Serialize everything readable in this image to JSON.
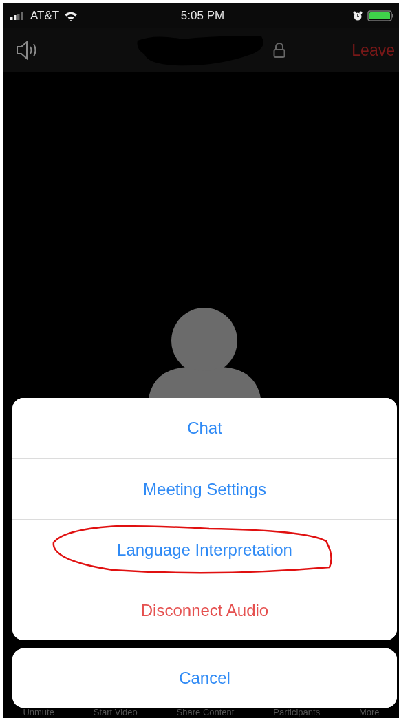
{
  "status_bar": {
    "carrier": "AT&T",
    "time": "5:05 PM"
  },
  "top_bar": {
    "leave": "Leave"
  },
  "action_sheet": {
    "items": [
      {
        "label": "Chat",
        "kind": "default",
        "circled": false
      },
      {
        "label": "Meeting Settings",
        "kind": "default",
        "circled": false
      },
      {
        "label": "Language Interpretation",
        "kind": "default",
        "circled": true
      },
      {
        "label": "Disconnect Audio",
        "kind": "destructive",
        "circled": false
      }
    ],
    "cancel": "Cancel"
  },
  "toolbar": [
    "Unmute",
    "Start Video",
    "Share Content",
    "Participants",
    "More"
  ]
}
